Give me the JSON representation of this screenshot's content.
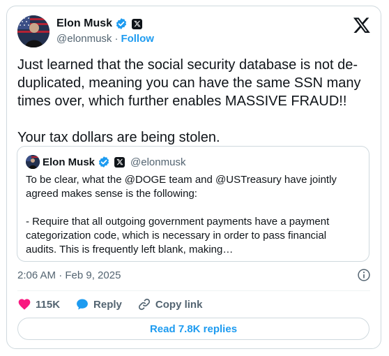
{
  "author": {
    "name": "Elon Musk",
    "handle": "@elonmusk",
    "separator": "·",
    "follow_label": "Follow"
  },
  "tweet": {
    "text": "Just learned that the social security database is not de-\nduplicated, meaning you can have the same SSN many\ntimes over, which further enables MASSIVE FRAUD!!\n\nYour tax dollars are being stolen."
  },
  "quote": {
    "name": "Elon Musk",
    "handle": "@elonmusk",
    "text": "To be clear, what the @DOGE team and @USTreasury have jointly\nagreed makes sense is the following:\n\n- Require that all outgoing government payments have a payment\ncategorization code, which is necessary in order to pass financial\naudits. This is frequently left blank, making…"
  },
  "meta": {
    "timestamp": "2:06 AM · Feb 9, 2025"
  },
  "actions": {
    "likes": "115K",
    "reply_label": "Reply",
    "copy_label": "Copy link"
  },
  "replies_button": "Read 7.8K replies",
  "colors": {
    "accent": "#1d9bf0",
    "like": "#f91880",
    "text": "#0f1419",
    "secondary": "#536471",
    "border": "#cfd9de"
  },
  "icons": [
    "verified-badge-icon",
    "x-affiliation-icon",
    "x-logo-icon",
    "info-icon",
    "heart-icon",
    "reply-icon",
    "link-icon"
  ]
}
